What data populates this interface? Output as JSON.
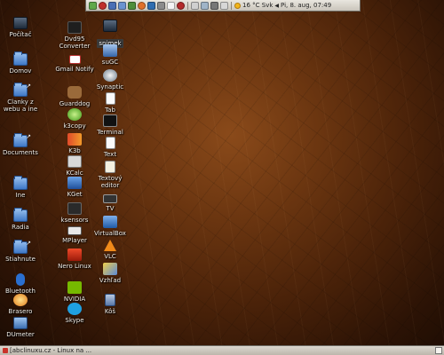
{
  "panel": {
    "weather": "16 °C Svk",
    "clock": "Pi, 8. aug, 07:49"
  },
  "desktop": {
    "col1": [
      {
        "label": "Počítač",
        "icon": "computer-icon"
      },
      {
        "label": "Domov",
        "icon": "home-folder-icon"
      },
      {
        "label": "Clanky z webu a ine",
        "icon": "folder-icon"
      },
      {
        "label": "Documents",
        "icon": "folder-icon"
      },
      {
        "label": "Ine",
        "icon": "folder-icon"
      },
      {
        "label": "Radia",
        "icon": "folder-icon"
      },
      {
        "label": "Stiahnute",
        "icon": "folder-icon"
      },
      {
        "label": "Bluetooth",
        "icon": "bluetooth-icon"
      },
      {
        "label": "Brasero",
        "icon": "brasero-icon"
      },
      {
        "label": "DUmeter",
        "icon": "dumeter-icon"
      }
    ],
    "col2": [
      {
        "label": "Dvd95 Converter",
        "icon": "dvd-icon"
      },
      {
        "label": "Gmail Notify",
        "icon": "gmail-icon"
      },
      {
        "label": "Guarddog",
        "icon": "guarddog-icon"
      },
      {
        "label": "k3copy",
        "icon": "k3copy-icon"
      },
      {
        "label": "K3b",
        "icon": "k3b-icon"
      },
      {
        "label": "KCalc",
        "icon": "calculator-icon"
      },
      {
        "label": "KGet",
        "icon": "download-icon"
      },
      {
        "label": "ksensors",
        "icon": "sensors-icon"
      },
      {
        "label": "MPlayer",
        "icon": "mplayer-icon"
      },
      {
        "label": "Nero Linux",
        "icon": "nero-icon"
      },
      {
        "label": "NVIDIA",
        "icon": "nvidia-icon"
      },
      {
        "label": "Skype",
        "icon": "skype-icon"
      }
    ],
    "col3": [
      {
        "label": "snimek",
        "icon": "image-icon"
      },
      {
        "label": "suGC",
        "icon": "sugc-icon"
      },
      {
        "label": "Synaptic",
        "icon": "synaptic-icon"
      },
      {
        "label": "Tab",
        "icon": "document-icon"
      },
      {
        "label": "Terminal",
        "icon": "terminal-icon"
      },
      {
        "label": "Text",
        "icon": "text-icon"
      },
      {
        "label": "Textový editor",
        "icon": "text-editor-icon"
      },
      {
        "label": "TV",
        "icon": "tv-icon"
      },
      {
        "label": "VirtualBox",
        "icon": "virtualbox-icon"
      },
      {
        "label": "VLC",
        "icon": "vlc-icon"
      },
      {
        "label": "Vzhľad",
        "icon": "appearance-icon"
      },
      {
        "label": "Kôš",
        "icon": "trash-icon"
      }
    ]
  },
  "taskbar": {
    "task_label": "[abclinuxu.cz - Linux na ..."
  },
  "colors": {
    "desktop_bg": "#5a2c0e",
    "panel_bg": "#dcd8d0",
    "folder_blue": "#4a86d6"
  }
}
